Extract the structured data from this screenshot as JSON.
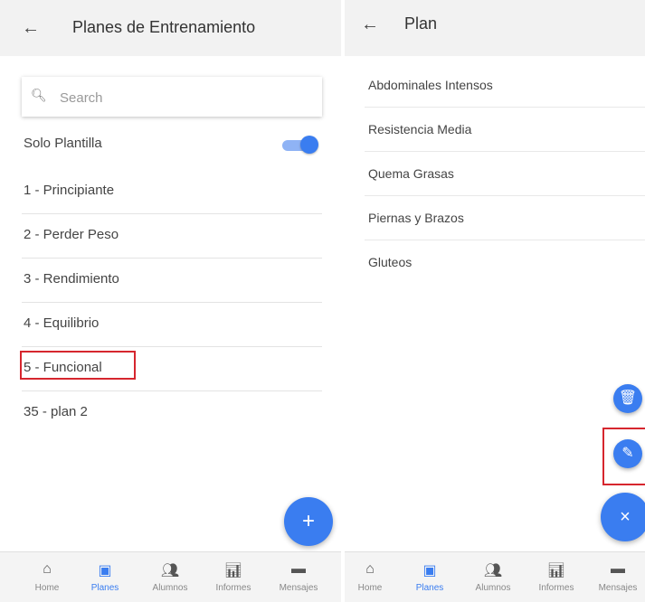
{
  "left_screen": {
    "title": "Planes de Entrenamiento",
    "back_icon": "arrow-left-icon",
    "search": {
      "placeholder": "Search",
      "value": ""
    },
    "toggle": {
      "label": "Solo Plantilla",
      "on": true
    },
    "plans": [
      {
        "label": "1 - Principiante"
      },
      {
        "label": "2 - Perder Peso"
      },
      {
        "label": "3 - Rendimiento"
      },
      {
        "label": "4 - Equilibrio"
      },
      {
        "label": "5 - Funcional"
      },
      {
        "label": "35 - plan 2"
      }
    ],
    "highlighted_index": 4,
    "fab_add": "+"
  },
  "right_screen": {
    "title": "Plan",
    "back_icon": "arrow-left-icon",
    "exercises": [
      {
        "label": "Abdominales Intensos"
      },
      {
        "label": "Resistencia Media"
      },
      {
        "label": "Quema Grasas"
      },
      {
        "label": "Piernas y Brazos"
      },
      {
        "label": "Gluteos"
      }
    ],
    "fab_delete_icon": "trash-icon",
    "fab_edit_icon": "pencil-icon",
    "fab_close": "×"
  },
  "bottom_nav": {
    "items": [
      {
        "label": "Home",
        "icon": "home-icon",
        "active": false
      },
      {
        "label": "Planes",
        "icon": "clipboard-icon",
        "active": true
      },
      {
        "label": "Alumnos",
        "icon": "people-icon",
        "active": false
      },
      {
        "label": "Informes",
        "icon": "chart-icon",
        "active": false
      },
      {
        "label": "Mensajes",
        "icon": "message-icon",
        "active": false
      }
    ]
  },
  "colors": {
    "accent": "#3a7df0",
    "highlight_box": "#d6262e",
    "appbar_bg": "#f2f2f2"
  }
}
